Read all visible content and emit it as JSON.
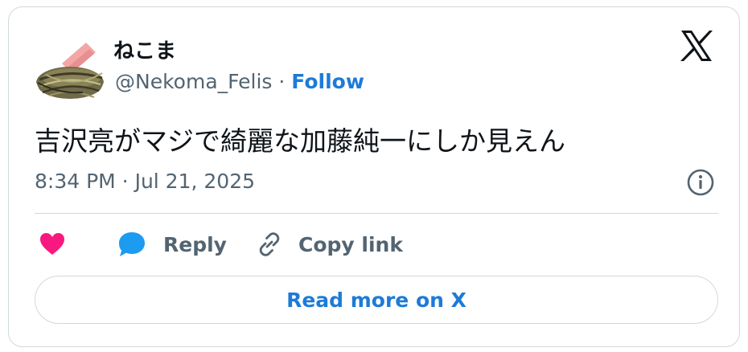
{
  "user": {
    "display_name": "ねこま",
    "handle": "@Nekoma_Felis",
    "separator": " · ",
    "follow_label": "Follow"
  },
  "tweet": {
    "text": "吉沢亮がマジで綺麗な加藤純一にしか見えん",
    "timestamp": "8:34 PM · Jul 21, 2025"
  },
  "actions": {
    "like_icon": "heart-icon",
    "reply_label": "Reply",
    "copy_label": "Copy link"
  },
  "read_more_label": "Read more on X",
  "colors": {
    "accent": "#1d7bd8",
    "like": "#f91880",
    "reply_icon": "#1d9bf0",
    "muted": "#536471",
    "border": "#cfd9de"
  }
}
